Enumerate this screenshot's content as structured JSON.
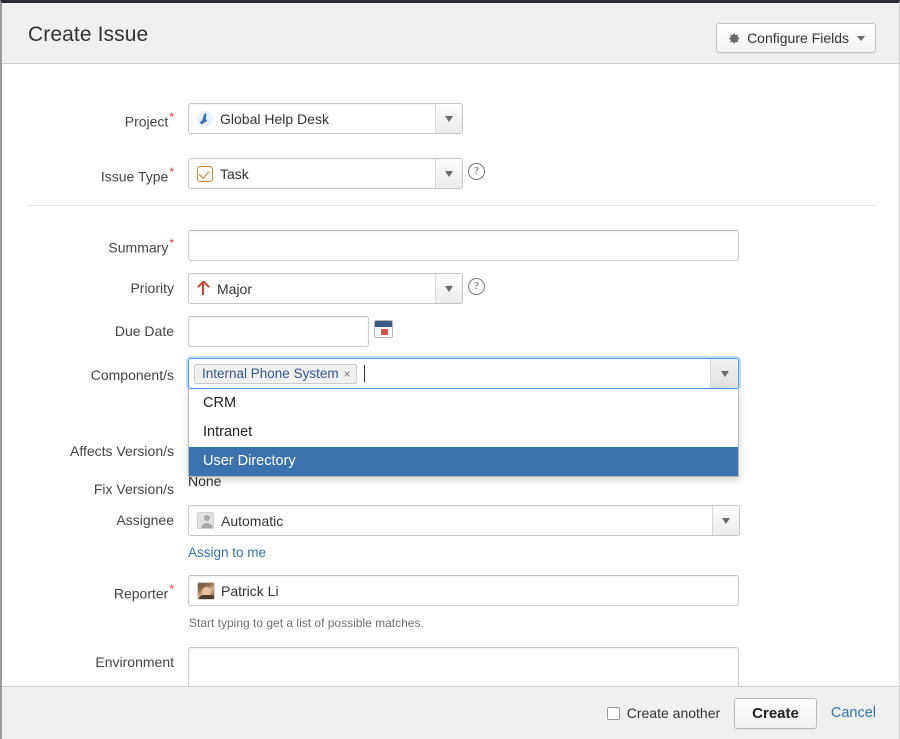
{
  "header": {
    "title": "Create Issue",
    "configure_fields_label": "Configure Fields",
    "gear_icon": "gear-icon",
    "caret_icon": "chevron-down-icon"
  },
  "form": {
    "project": {
      "label": "Project",
      "required": true,
      "value": "Global Help Desk",
      "icon": "rocket-icon"
    },
    "issue_type": {
      "label": "Issue Type",
      "required": true,
      "value": "Task",
      "icon": "task-checkbox-icon",
      "help": "?"
    },
    "summary": {
      "label": "Summary",
      "required": true,
      "value": "",
      "placeholder": ""
    },
    "priority": {
      "label": "Priority",
      "required": false,
      "value": "Major",
      "icon": "priority-major-up-arrow-icon",
      "help": "?"
    },
    "due_date": {
      "label": "Due Date",
      "required": false,
      "value": "",
      "placeholder": "",
      "icon": "calendar-icon"
    },
    "components": {
      "label": "Component/s",
      "required": false,
      "selected": [
        "Internal Phone System"
      ],
      "remove_icon": "close-icon",
      "arrow_icon": "chevron-down-icon",
      "options": [
        {
          "label": "CRM",
          "selected": false
        },
        {
          "label": "Intranet",
          "selected": false
        },
        {
          "label": "User Directory",
          "selected": true
        }
      ]
    },
    "affects_versions": {
      "label": "Affects Version/s",
      "required": false,
      "value": ""
    },
    "fix_versions": {
      "label": "Fix Version/s",
      "required": false,
      "value": "None"
    },
    "assignee": {
      "label": "Assignee",
      "required": false,
      "value": "Automatic",
      "icon": "generic-avatar-icon",
      "assign_to_me_label": "Assign to me"
    },
    "reporter": {
      "label": "Reporter",
      "required": true,
      "value": "Patrick Li",
      "icon": "user-avatar-photo",
      "hint": "Start typing to get a list of possible matches."
    },
    "environment": {
      "label": "Environment",
      "value": "",
      "placeholder": ""
    }
  },
  "footer": {
    "create_another_label": "Create another",
    "create_another_checked": false,
    "create_label": "Create",
    "cancel_label": "Cancel"
  },
  "colors": {
    "header_bg": "#f0f0f0",
    "required_star": "#d04437",
    "link": "#3572b0",
    "dropdown_selected_bg": "#3b73af",
    "focus_border": "#4c9aff",
    "pill_text": "#32588f"
  }
}
